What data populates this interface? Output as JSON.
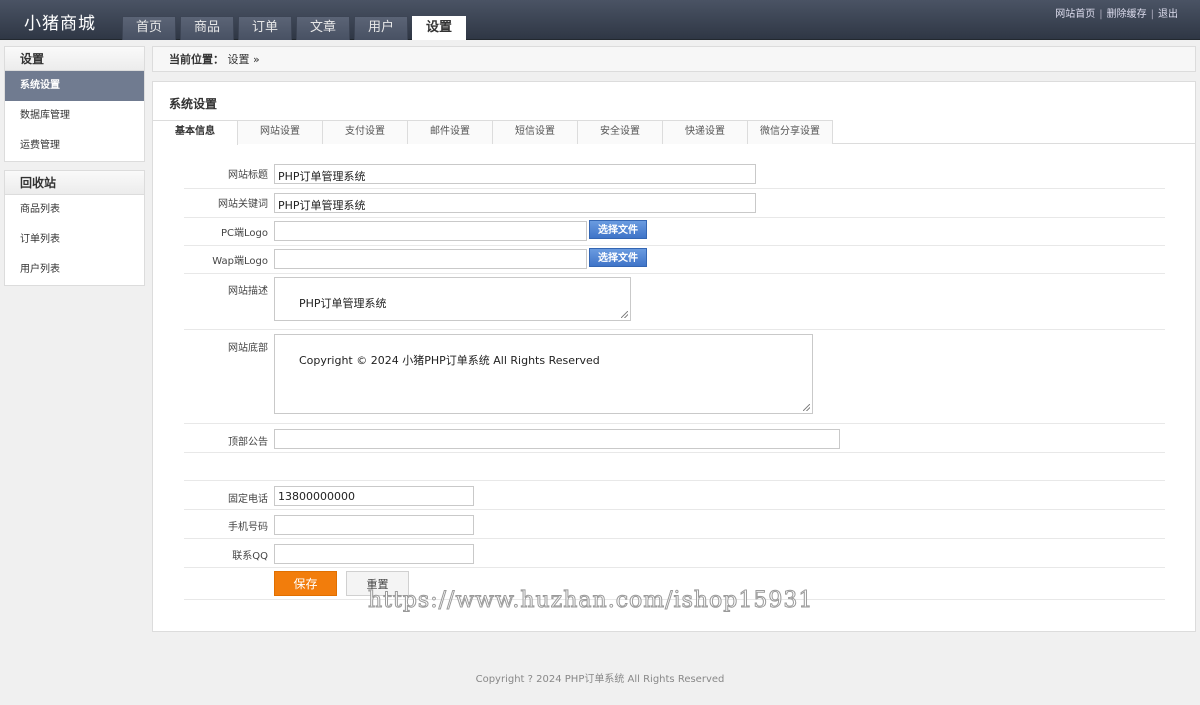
{
  "app": {
    "logo": "小猪商城"
  },
  "nav": [
    "首页",
    "商品",
    "订单",
    "文章",
    "用户",
    "设置"
  ],
  "toplinks": [
    "网站首页",
    "删除缓存",
    "退出"
  ],
  "sidebar": {
    "sections": [
      {
        "title": "设置",
        "items": [
          "系统设置",
          "数据库管理",
          "运费管理"
        ]
      },
      {
        "title": "回收站",
        "items": [
          "商品列表",
          "订单列表",
          "用户列表"
        ]
      }
    ]
  },
  "breadcrumb": {
    "label": "当前位置：",
    "current": "设置",
    "arrow": "»"
  },
  "panel": {
    "title": "系统设置",
    "tabs": [
      "基本信息",
      "网站设置",
      "支付设置",
      "邮件设置",
      "短信设置",
      "安全设置",
      "快递设置",
      "微信分享设置"
    ]
  },
  "form": {
    "site_title": {
      "label": "网站标题",
      "value": "PHP订单管理系统"
    },
    "site_keywords": {
      "label": "网站关键词",
      "value": "PHP订单管理系统"
    },
    "pc_logo": {
      "label": "PC端Logo",
      "value": "",
      "button": "选择文件"
    },
    "wap_logo": {
      "label": "Wap端Logo",
      "value": "",
      "button": "选择文件"
    },
    "site_desc": {
      "label": "网站描述",
      "value": "PHP订单管理系统"
    },
    "site_footer": {
      "label": "网站底部",
      "value": "Copyright © 2024 小猪PHP订单系统 All Rights Reserved"
    },
    "top_notice": {
      "label": "顶部公告",
      "value": ""
    },
    "phone": {
      "label": "固定电话",
      "value": "13800000000"
    },
    "mobile": {
      "label": "手机号码",
      "value": ""
    },
    "qq": {
      "label": "联系QQ",
      "value": ""
    },
    "save_label": "保存",
    "reset_label": "重置"
  },
  "watermark": "https://www.huzhan.com/ishop15931",
  "footer": "Copyright ? 2024 PHP订单系统  All Rights Reserved",
  "colors": {
    "topbar": "#3a4252",
    "sidebar_active": "#707b90",
    "save_button": "#f27d0c",
    "file_button": "#4a80d0"
  }
}
